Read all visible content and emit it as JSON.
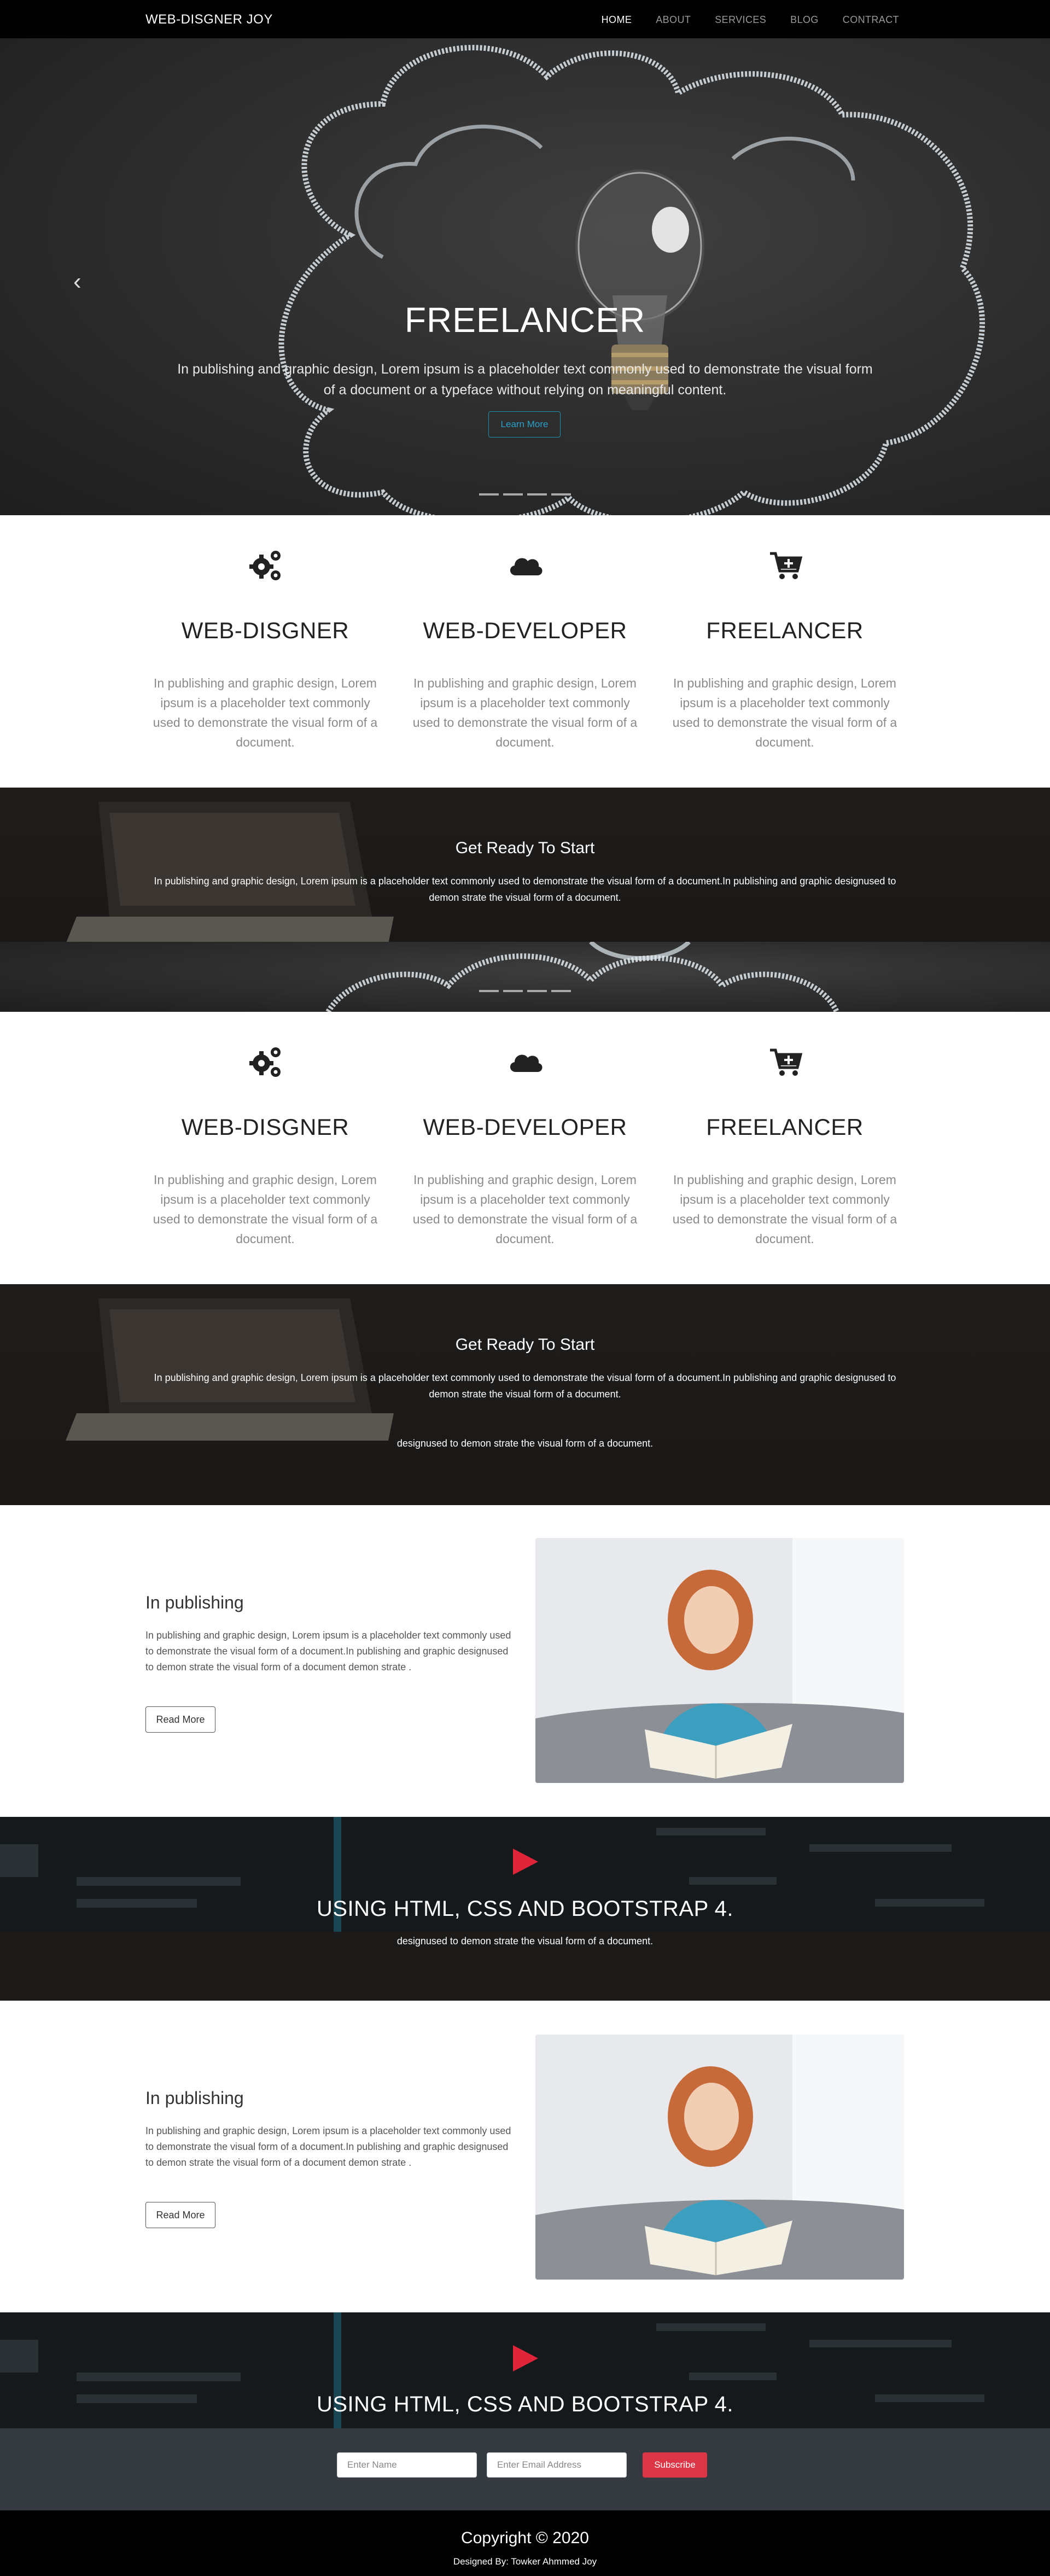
{
  "navbar": {
    "brand": "WEB-DISGNER JOY",
    "links": [
      "HOME",
      "ABOUT",
      "SERVICES",
      "BLOG",
      "CONTRACT"
    ],
    "active": "HOME"
  },
  "hero": {
    "title": "FREELANCER",
    "text": "In publishing and graphic design, Lorem ipsum is a placeholder text commonly used to demonstrate the visual form of a document or a typeface without relying on meaningful content.",
    "button": "Learn More",
    "prev_icon": "chevron-left-icon"
  },
  "services": [
    {
      "icon": "gears-icon",
      "title": "WEB-DISGNER",
      "text": "In publishing and graphic design, Lorem ipsum is a placeholder text commonly used to demonstrate the visual form of a document."
    },
    {
      "icon": "cloud-icon",
      "title": "WEB-DEVELOPER",
      "text": "In publishing and graphic design, Lorem ipsum is a placeholder text commonly used to demonstrate the visual form of a document."
    },
    {
      "icon": "cart-plus-icon",
      "title": "FREELANCER",
      "text": "In publishing and graphic design, Lorem ipsum is a placeholder text commonly used to demonstrate the visual form of a document."
    }
  ],
  "ready": {
    "title": "Get Ready To Start",
    "text": "In publishing and graphic design, Lorem ipsum is a placeholder text commonly used to demonstrate the visual form of a document.In publishing and graphic designused to demon strate the visual form of a document.",
    "extra_line": "designused to demon strate the visual form of a document."
  },
  "about": {
    "title": "In publishing",
    "text": "In publishing and graphic design, Lorem ipsum is a placeholder text commonly used to demonstrate the visual form of a document.In publishing and graphic designused to demon strate the visual form of a document demon strate .",
    "button": "Read More"
  },
  "video": {
    "title": "USING HTML, CSS AND BOOTSTRAP 4.",
    "subtext": "designused to demon strate the visual form of a document.",
    "play_icon": "play-icon"
  },
  "subscribe": {
    "name_placeholder": "Enter Name",
    "email_placeholder": "Enter Email Address",
    "button": "Subscribe",
    "button_color": "#dc3545"
  },
  "footer": {
    "copyright": "Copyright © 2020",
    "designed_by": "Designed By: Towker Ahmmed Joy"
  }
}
